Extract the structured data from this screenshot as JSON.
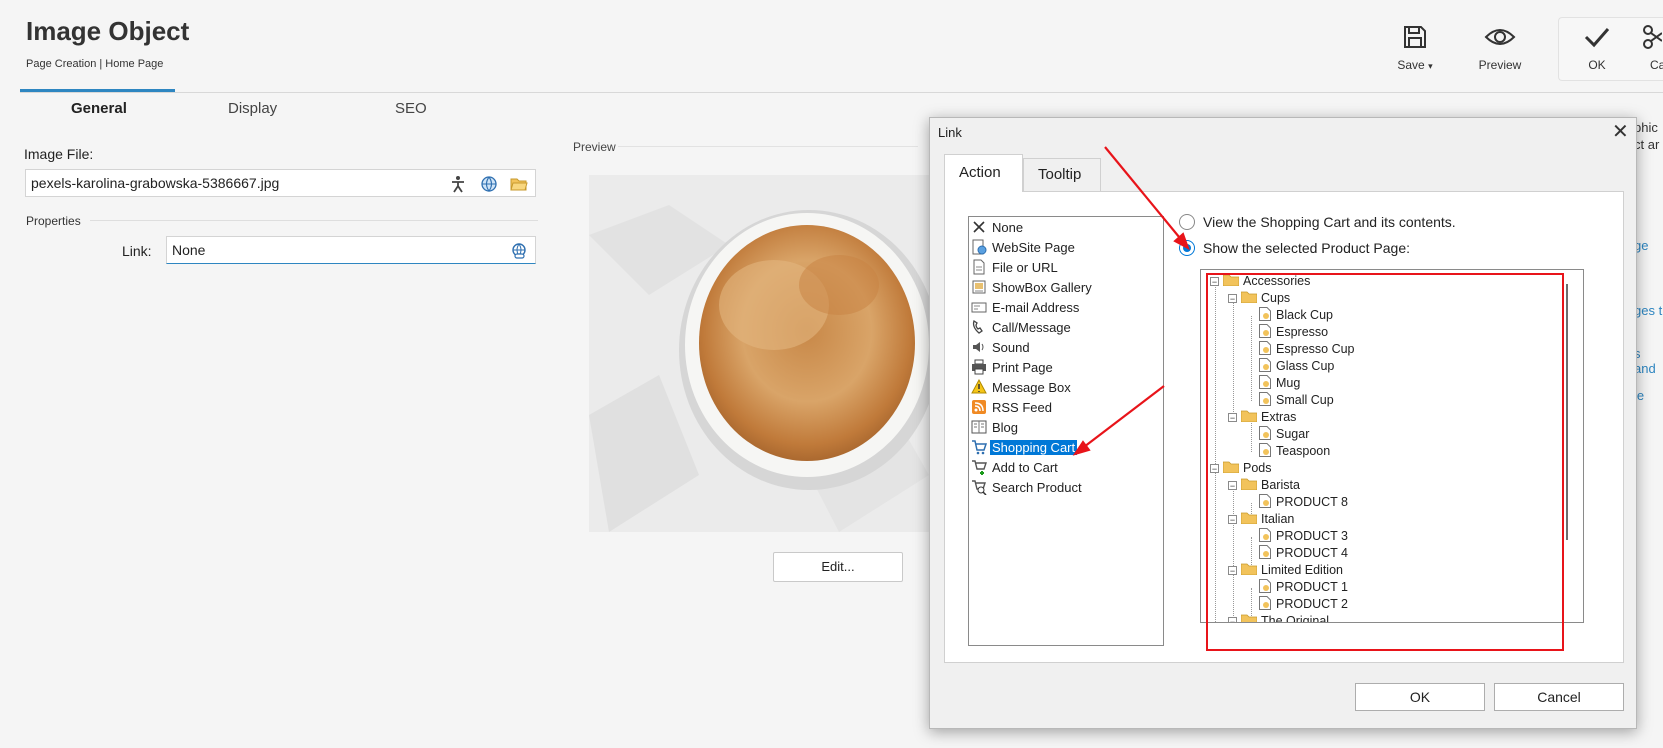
{
  "header": {
    "title": "Image Object",
    "breadcrumb": "Page Creation | Home Page",
    "toolbar": {
      "save_label": "Save",
      "save_caret": "▾",
      "preview_label": "Preview",
      "ok_label": "OK",
      "cancel_label_partial": "Ca"
    }
  },
  "tabs": [
    "General",
    "Display",
    "SEO"
  ],
  "form": {
    "image_file_label": "Image File:",
    "image_file_value": "pexels-karolina-grabowska-5386667.jpg",
    "properties_label": "Properties",
    "link_label": "Link:",
    "link_value": "None"
  },
  "preview": {
    "label": "Preview",
    "edit_button": "Edit..."
  },
  "background_cut_text": [
    "phic",
    "ct ar",
    "ge",
    "ges t",
    "s and",
    "le"
  ],
  "dialog": {
    "title": "Link",
    "close_glyph": "✕",
    "tabs": [
      "Action",
      "Tooltip"
    ],
    "action_items": [
      {
        "label": "None",
        "icon": "x-icon"
      },
      {
        "label": "WebSite Page",
        "icon": "website-page-icon"
      },
      {
        "label": "File or URL",
        "icon": "file-url-icon"
      },
      {
        "label": "ShowBox Gallery",
        "icon": "gallery-icon"
      },
      {
        "label": "E-mail Address",
        "icon": "email-icon"
      },
      {
        "label": "Call/Message",
        "icon": "phone-icon"
      },
      {
        "label": "Sound",
        "icon": "sound-icon"
      },
      {
        "label": "Print Page",
        "icon": "printer-icon"
      },
      {
        "label": "Message Box",
        "icon": "warning-icon"
      },
      {
        "label": "RSS Feed",
        "icon": "rss-icon"
      },
      {
        "label": "Blog",
        "icon": "blog-icon"
      },
      {
        "label": "Shopping Cart",
        "icon": "cart-icon",
        "selected": true
      },
      {
        "label": "Add to Cart",
        "icon": "add-cart-icon"
      },
      {
        "label": "Search Product",
        "icon": "search-product-icon"
      }
    ],
    "radio_view_cart": "View the Shopping Cart and its contents.",
    "radio_show_product": "Show the selected Product Page:",
    "radio_selected": "show_product",
    "tree": [
      {
        "label": "Accessories",
        "level": 0,
        "type": "folder"
      },
      {
        "label": "Cups",
        "level": 1,
        "type": "folder"
      },
      {
        "label": "Black Cup",
        "level": 2,
        "type": "page"
      },
      {
        "label": "Espresso",
        "level": 2,
        "type": "page"
      },
      {
        "label": "Espresso Cup",
        "level": 2,
        "type": "page"
      },
      {
        "label": "Glass Cup",
        "level": 2,
        "type": "page"
      },
      {
        "label": "Mug",
        "level": 2,
        "type": "page"
      },
      {
        "label": "Small Cup",
        "level": 2,
        "type": "page"
      },
      {
        "label": "Extras",
        "level": 1,
        "type": "folder"
      },
      {
        "label": "Sugar",
        "level": 2,
        "type": "page"
      },
      {
        "label": "Teaspoon",
        "level": 2,
        "type": "page"
      },
      {
        "label": "Pods",
        "level": 0,
        "type": "folder"
      },
      {
        "label": "Barista",
        "level": 1,
        "type": "folder"
      },
      {
        "label": "PRODUCT 8",
        "level": 2,
        "type": "page"
      },
      {
        "label": "Italian",
        "level": 1,
        "type": "folder"
      },
      {
        "label": "PRODUCT 3",
        "level": 2,
        "type": "page"
      },
      {
        "label": "PRODUCT 4",
        "level": 2,
        "type": "page"
      },
      {
        "label": "Limited Edition",
        "level": 1,
        "type": "folder"
      },
      {
        "label": "PRODUCT 1",
        "level": 2,
        "type": "page"
      },
      {
        "label": "PRODUCT 2",
        "level": 2,
        "type": "page"
      },
      {
        "label": "The Original",
        "level": 1,
        "type": "folder"
      }
    ],
    "ok_button": "OK",
    "cancel_button": "Cancel"
  },
  "colors": {
    "accent": "#2e86c1",
    "selection": "#0078d7",
    "annotation_red": "#e8141a",
    "folder": "#f2c35b"
  }
}
